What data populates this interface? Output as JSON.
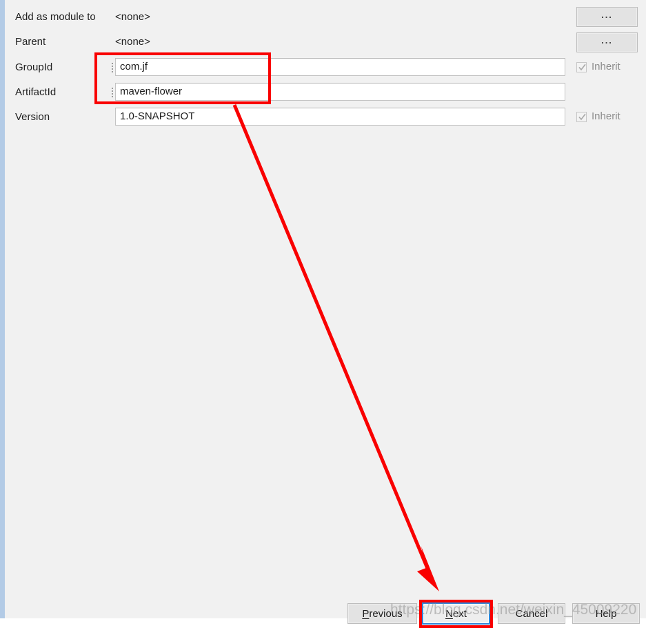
{
  "dialog": {
    "fields": [
      {
        "label": "Add as module to",
        "type": "static",
        "value": "<none>"
      },
      {
        "label": "Parent",
        "type": "static",
        "value": "<none>"
      },
      {
        "label": "GroupId",
        "type": "input",
        "value": "com.jf",
        "inherit_label": "Inherit",
        "inherit_checked": true
      },
      {
        "label": "ArtifactId",
        "type": "input",
        "value": "maven-flower",
        "inherit_label": "",
        "inherit_checked": false
      },
      {
        "label": "Version",
        "type": "input",
        "value": "1.0-SNAPSHOT",
        "inherit_label": "Inherit",
        "inherit_checked": true
      }
    ],
    "browse_buttons": [
      {
        "label": "...",
        "name": "add-as-module-to-browse-button"
      },
      {
        "label": "...",
        "name": "parent-browse-button"
      }
    ],
    "footer_buttons": [
      {
        "label": "Previous",
        "mnemonic": "P",
        "focused": false
      },
      {
        "label": "Next",
        "mnemonic": "N",
        "focused": true
      },
      {
        "label": "Cancel",
        "mnemonic": "",
        "focused": false
      },
      {
        "label": "Help",
        "mnemonic": "",
        "focused": false
      }
    ]
  },
  "annotations": {
    "highlight_color": "#f90000",
    "focus_color": "#2f82d6",
    "rect_fields_label": "groupid-artifactid-highlight",
    "rect_next_label": "next-button-highlight"
  },
  "watermark": {
    "text": "https://blog.csdn.net/weixin_45009220"
  }
}
